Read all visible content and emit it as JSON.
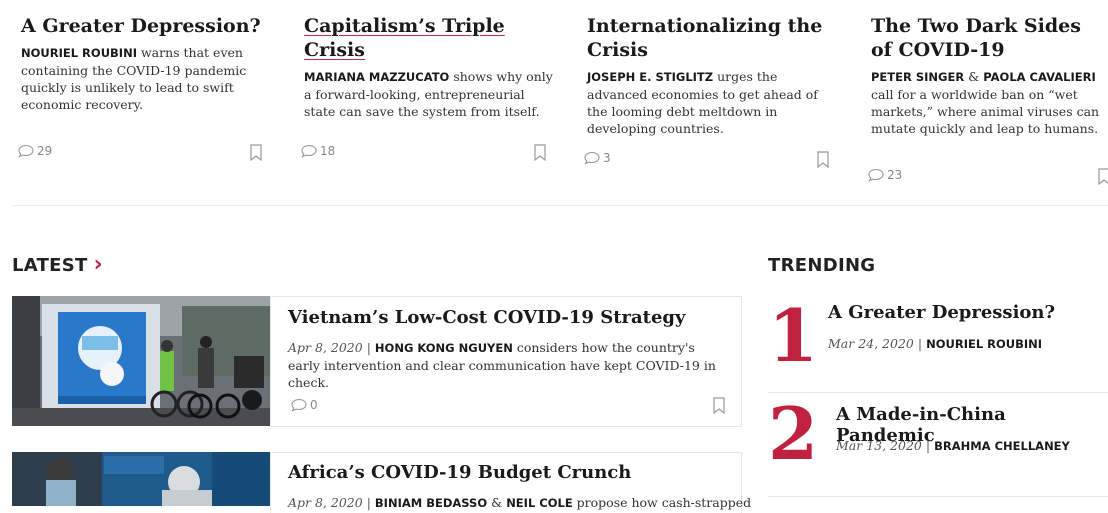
{
  "top_cards": [
    {
      "title": "A Greater Depression?",
      "author": "NOURIEL ROUBINI",
      "desc": " warns that even containing the COVID-19 pandemic quickly is unlikely to lead to swift economic recovery.",
      "comments": "29"
    },
    {
      "title": "Capitalism’s Triple Crisis",
      "author": "MARIANA MAZZUCATO",
      "desc": " shows why only a forward-looking, entrepreneurial state can save the system from itself.",
      "comments": "18"
    },
    {
      "title": "Internationalizing the Crisis",
      "author": "JOSEPH E. STIGLITZ",
      "desc": " urges the advanced economies to get ahead of the looming debt meltdown in developing countries.",
      "comments": "3"
    },
    {
      "title": "The Two Dark Sides of COVID-19",
      "author": "PETER SINGER",
      "author_sep": " & ",
      "author2": "PAOLA CAVALIERI",
      "desc": " call for a worldwide ban on “wet markets,” where animal viruses can mutate quickly and leap to humans.",
      "comments": "23"
    }
  ],
  "latest": {
    "heading": "LATEST",
    "chevron": "›",
    "items": [
      {
        "title": "Vietnam’s Low-Cost COVID-19 Strategy",
        "date": "Apr 8, 2020",
        "sep": "|",
        "author": "HONG KONG NGUYEN",
        "desc": " considers how the country's early intervention and clear communication have kept COVID-19 in check.",
        "comments": "0"
      },
      {
        "title": "Africa’s COVID-19 Budget Crunch",
        "date": "Apr 8, 2020",
        "sep": "|",
        "author": "BINIAM BEDASSO",
        "author_sep": " & ",
        "author2": "NEIL COLE",
        "desc": " propose how cash-strapped"
      }
    ]
  },
  "trending": {
    "heading": "TRENDING",
    "items": [
      {
        "rank": "1",
        "title": "A Greater Depression?",
        "date": "Mar 24, 2020",
        "sep": "|",
        "author": "NOURIEL ROUBINI"
      },
      {
        "rank": "2",
        "title": "A Made-in-China Pandemic",
        "date": "Mar 13, 2020",
        "sep": "|",
        "author": "BRAHMA CHELLANEY"
      }
    ]
  },
  "icons": {
    "comment": "comment-bubble-icon",
    "bookmark": "bookmark-icon"
  },
  "colors": {
    "accent": "#c0213f"
  }
}
